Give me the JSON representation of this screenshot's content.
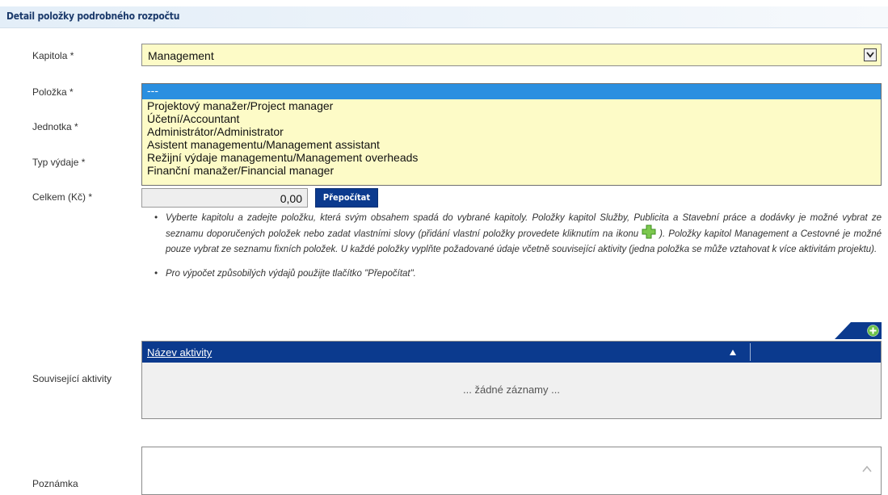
{
  "section": {
    "title": "Detail položky podrobného rozpočtu"
  },
  "labels": {
    "kapitola": "Kapitola *",
    "polozka": "Položka *",
    "jednotka": "Jednotka *",
    "typ_vydaje": "Typ výdaje *",
    "celkem": "Celkem (Kč) *",
    "souvisejici": "Související aktivity",
    "poznamka": "Poznámka"
  },
  "kapitola_select": {
    "value": "Management"
  },
  "polozka_dropdown": {
    "options": [
      "---",
      "Projektový manažer/Project manager",
      "Účetní/Accountant",
      "Administrátor/Administrator",
      "Asistent managementu/Management assistant",
      "Režijní výdaje managementu/Management overheads",
      "Finanční manažer/Financial manager"
    ],
    "selected_index": 0
  },
  "celkem": {
    "value": "0,00",
    "button_label": "Přepočítat"
  },
  "help": {
    "p1_part1": "Vyberte kapitolu a zadejte položku, která svým obsahem spadá do vybrané kapitoly. Položky kapitol Služby, Publicita a Stavební práce a dodávky je možné vybrat ze seznamu doporučených položek nebo zadat vlastními slovy (přidání vlastní položky provedete kliknutím na ikonu",
    "p1_part2": "). Položky kapitol Management a Cestovné je možné pouze vybrat ze seznamu fixních položek. U každé položky vyplňte požadované údaje včetně související aktivity (jedna položka se může vztahovat k více aktivitám projektu).",
    "p2": "Pro výpočet způsobilých výdajů použijte tlačítko \"Přepočítat\"."
  },
  "activities_grid": {
    "column_header": "Název aktivity",
    "empty_text": "... žádné záznamy ..."
  },
  "colors": {
    "header_blue": "#0b3a8e",
    "field_yellow": "#fdfbc7",
    "selected_option": "#2a8fe0",
    "add_green": "#6cc04a"
  }
}
